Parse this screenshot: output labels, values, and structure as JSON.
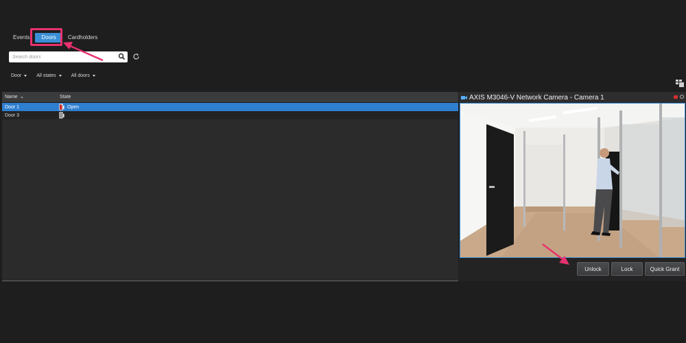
{
  "tabs": [
    {
      "label": "Events",
      "active": false
    },
    {
      "label": "Doors",
      "active": true
    },
    {
      "label": "Cardholders",
      "active": false
    }
  ],
  "search": {
    "placeholder": "Search doors",
    "value": ""
  },
  "filters": [
    {
      "label": "Door"
    },
    {
      "label": "All states"
    },
    {
      "label": "All doors"
    }
  ],
  "table": {
    "columns": [
      "Name",
      "State"
    ],
    "rows": [
      {
        "name": "Door 1",
        "state": "Open",
        "selected": true
      },
      {
        "name": "Door 3",
        "state": "",
        "selected": false
      }
    ]
  },
  "camera": {
    "title": "AXIS M3046-V Network Camera - Camera 1",
    "buttons": {
      "unlock": "Unlock",
      "lock": "Lock",
      "quick_grant": "Quick Grant"
    }
  },
  "colors": {
    "accent": "#3a8fd6",
    "highlight": "#e8316d",
    "background": "#1e1e1f"
  }
}
